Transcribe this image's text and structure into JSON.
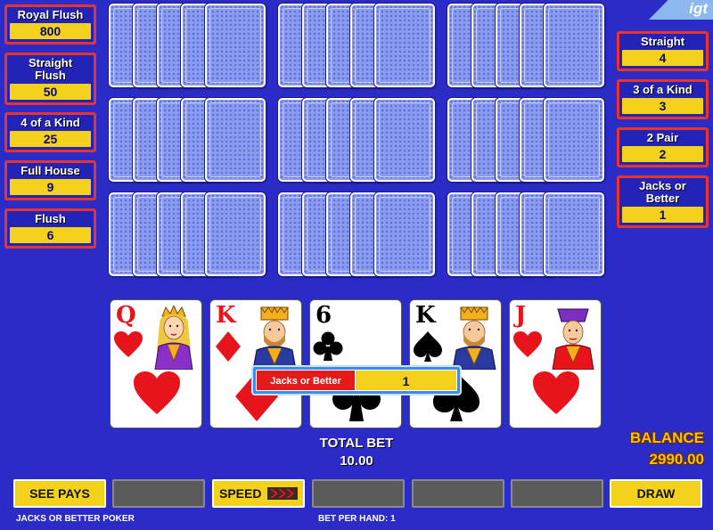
{
  "paytable_left": [
    {
      "name": "Royal Flush",
      "value": "800"
    },
    {
      "name": "Straight Flush",
      "value": "50"
    },
    {
      "name": "4 of a Kind",
      "value": "25"
    },
    {
      "name": "Full House",
      "value": "9"
    },
    {
      "name": "Flush",
      "value": "6"
    }
  ],
  "paytable_right": [
    {
      "name": "Straight",
      "value": "4"
    },
    {
      "name": "3 of a Kind",
      "value": "3"
    },
    {
      "name": "2 Pair",
      "value": "2"
    },
    {
      "name": "Jacks or Better",
      "value": "1"
    }
  ],
  "cards": [
    {
      "rank": "Q",
      "suit": "heart",
      "color": "#e8141c",
      "face": "queen"
    },
    {
      "rank": "K",
      "suit": "diamond",
      "color": "#e8141c",
      "face": "king"
    },
    {
      "rank": "6",
      "suit": "club",
      "color": "#000000",
      "face": "none"
    },
    {
      "rank": "K",
      "suit": "spade",
      "color": "#000000",
      "face": "king"
    },
    {
      "rank": "J",
      "suit": "heart",
      "color": "#e8141c",
      "face": "jack"
    }
  ],
  "result": {
    "hand": "Jacks or Better",
    "payout": "1"
  },
  "total_bet": {
    "label": "TOTAL BET",
    "value": "10.00"
  },
  "balance": {
    "label": "BALANCE",
    "value": "2990.00"
  },
  "buttons": {
    "see_pays": "SEE PAYS",
    "speed": "SPEED",
    "draw": "DRAW"
  },
  "footer": {
    "game_name": "JACKS OR BETTER POKER",
    "bet_per_hand": "BET PER HAND: 1"
  },
  "brand": "igt",
  "colors": {
    "background": "#2b2cc8",
    "paytable_border": "#e8342a",
    "paytable_value_bg": "#f4d21c",
    "balance_text": "#f4c20d"
  }
}
